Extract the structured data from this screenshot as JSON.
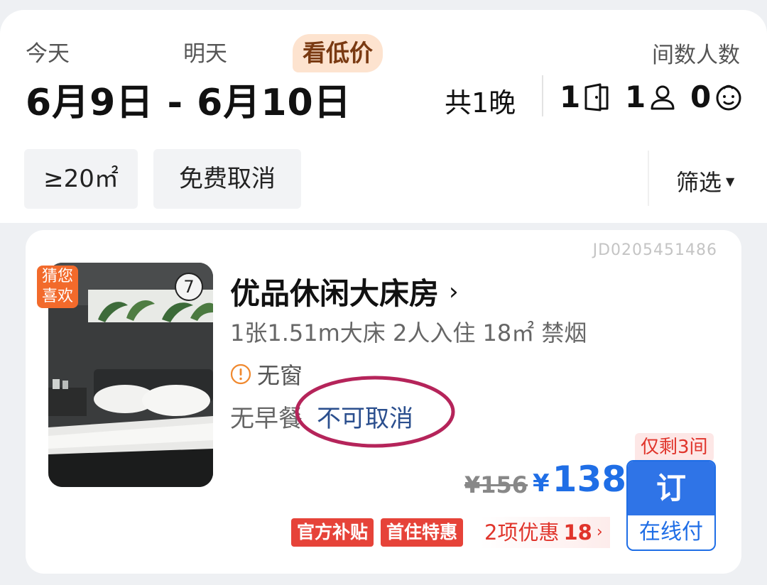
{
  "dates": {
    "checkin_label": "今天",
    "checkout_label": "明天",
    "range": "6月9日 - 6月10日",
    "low_price_tag": "看低价",
    "nights": "共1晚"
  },
  "occupancy": {
    "label": "间数人数",
    "rooms": "1",
    "adults": "1",
    "children": "0"
  },
  "filters": {
    "chips": [
      "≥20㎡",
      "免费取消"
    ],
    "filter_label": "筛选"
  },
  "room": {
    "id": "JD0205451486",
    "name": "优品休闲大床房",
    "spec": "1张1.51m大床  2人入住  18㎡  禁烟",
    "warning": "无窗",
    "breakfast": "无早餐",
    "cancel_policy": "不可取消",
    "photo_count": "7",
    "badge": [
      "猜您",
      "喜欢"
    ],
    "remaining": "仅剩3间",
    "original_price": "¥156",
    "price_symbol": "¥",
    "price": "138",
    "book_label": "订",
    "book_sub": "在线付",
    "tags": [
      "官方补贴",
      "首住特惠"
    ],
    "promo_label": "2项优惠",
    "promo_amount": "18"
  },
  "colors": {
    "price_blue": "#1f6ee6",
    "alert_red": "#e0342b",
    "annotation": "#b5245a"
  }
}
